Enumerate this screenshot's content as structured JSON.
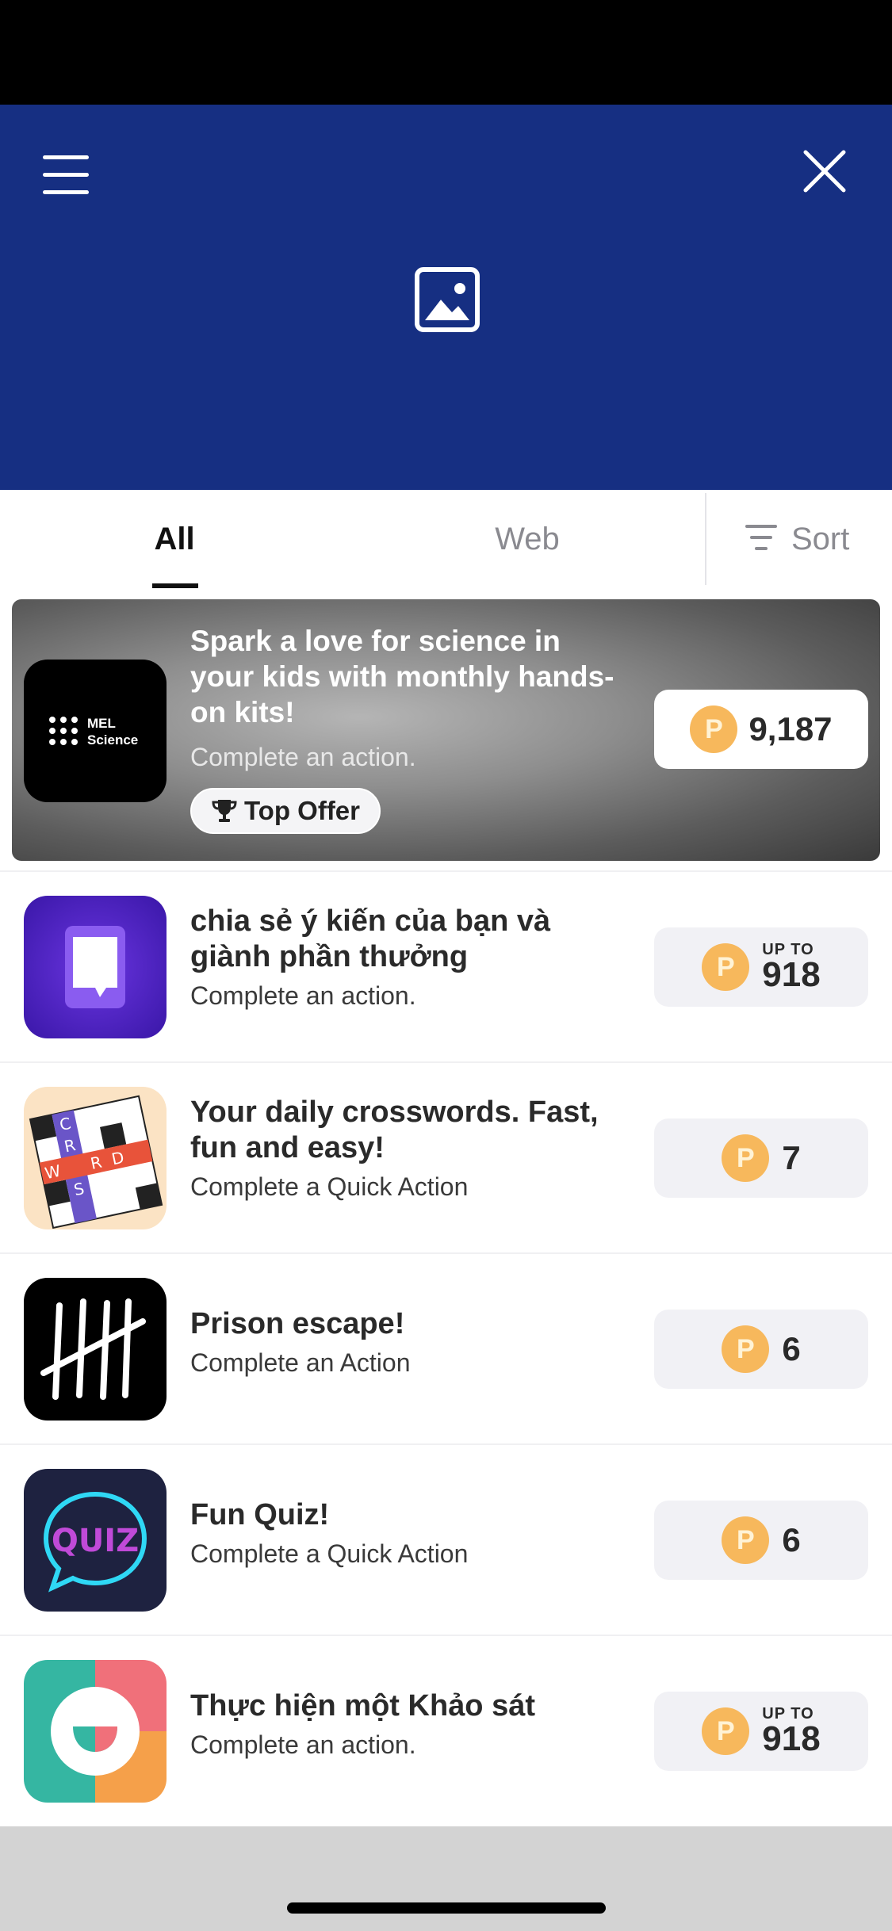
{
  "colors": {
    "header_bg": "#162f82",
    "coin": "#f7b85c",
    "reward_bg": "#f1f1f5"
  },
  "header": {
    "menu_icon": "hamburger-menu-icon",
    "close_icon": "close-icon",
    "banner_icon": "image-placeholder-icon"
  },
  "tabs": {
    "all": "All",
    "web": "Web",
    "sort": "Sort",
    "active": "All"
  },
  "featured": {
    "icon_text_1": "MEL",
    "icon_text_2": "Science",
    "title": "Spark a love for science in your kids with monthly hands-on kits!",
    "subtitle": "Complete an action.",
    "badge": "Top Offer",
    "reward": "9,187"
  },
  "coin_letter": "P",
  "offers": [
    {
      "title": "chia sẻ ý kiến của bạn và giành phần thưởng",
      "subtitle": "Complete an action.",
      "reward_prefix": "UP TO",
      "reward": "918"
    },
    {
      "title": "Your daily crosswords. Fast, fun and easy!",
      "subtitle": "Complete a Quick Action",
      "reward": "7"
    },
    {
      "title": "Prison escape!",
      "subtitle": "Complete an Action",
      "reward": "6"
    },
    {
      "title": "Fun Quiz!",
      "subtitle": "Complete a Quick Action",
      "reward": "6",
      "icon_text": "QUIZ"
    },
    {
      "title": "Thực hiện một Khảo sát",
      "subtitle": "Complete an action.",
      "reward_prefix": "UP TO",
      "reward": "918"
    }
  ]
}
